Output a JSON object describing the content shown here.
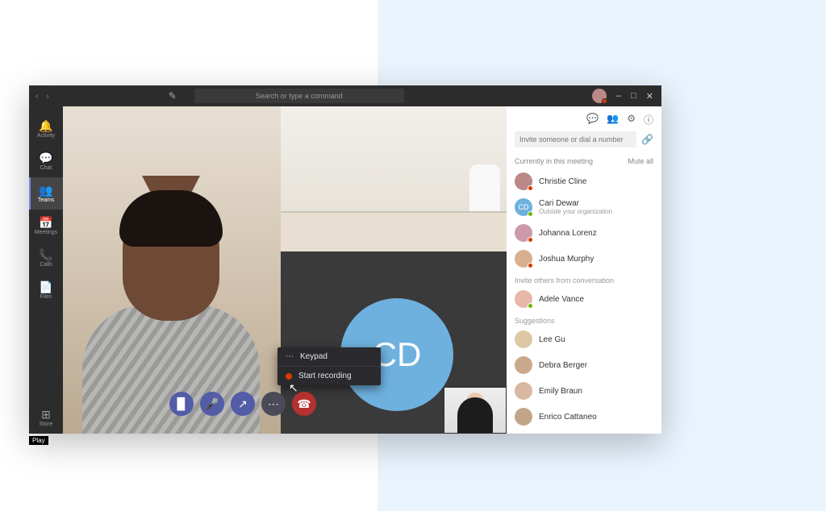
{
  "titlebar": {
    "search_placeholder": "Search or type a command"
  },
  "rail": {
    "items": [
      {
        "label": "Activity"
      },
      {
        "label": "Chat"
      },
      {
        "label": "Teams"
      },
      {
        "label": "Meetings"
      },
      {
        "label": "Calls"
      },
      {
        "label": "Files"
      }
    ],
    "store": "Store",
    "play_hint": "Play"
  },
  "stage": {
    "avatar_initials": "CD",
    "menu": {
      "keypad": "Keypad",
      "start_recording": "Start recording"
    }
  },
  "panel": {
    "invite_placeholder": "Invite someone or dial a number",
    "current_label": "Currently in this meeting",
    "mute_all": "Mute all",
    "current": [
      {
        "name": "Christie Cline",
        "sub": "",
        "color": "#b88",
        "presence": "#d83b01"
      },
      {
        "name": "Cari Dewar",
        "sub": "Outside your organization",
        "color": "#6eb1de",
        "presence": "#6bb700",
        "initials": "CD"
      },
      {
        "name": "Johanna Lorenz",
        "sub": "",
        "color": "#c9a",
        "presence": "#d83b01"
      },
      {
        "name": "Joshua Murphy",
        "sub": "",
        "color": "#d8b090",
        "presence": "#d83b01"
      }
    ],
    "invite_others_label": "Invite others from conversation",
    "invite_others": [
      {
        "name": "Adele Vance",
        "color": "#e7b8a8",
        "presence": "#6bb700"
      }
    ],
    "suggestions_label": "Suggestions",
    "suggestions": [
      {
        "name": "Lee Gu",
        "color": "#dec7a4"
      },
      {
        "name": "Debra Berger",
        "color": "#caa98c"
      },
      {
        "name": "Emily Braun",
        "color": "#d8b8a0"
      },
      {
        "name": "Enrico Cattaneo",
        "color": "#c2a588"
      }
    ]
  }
}
